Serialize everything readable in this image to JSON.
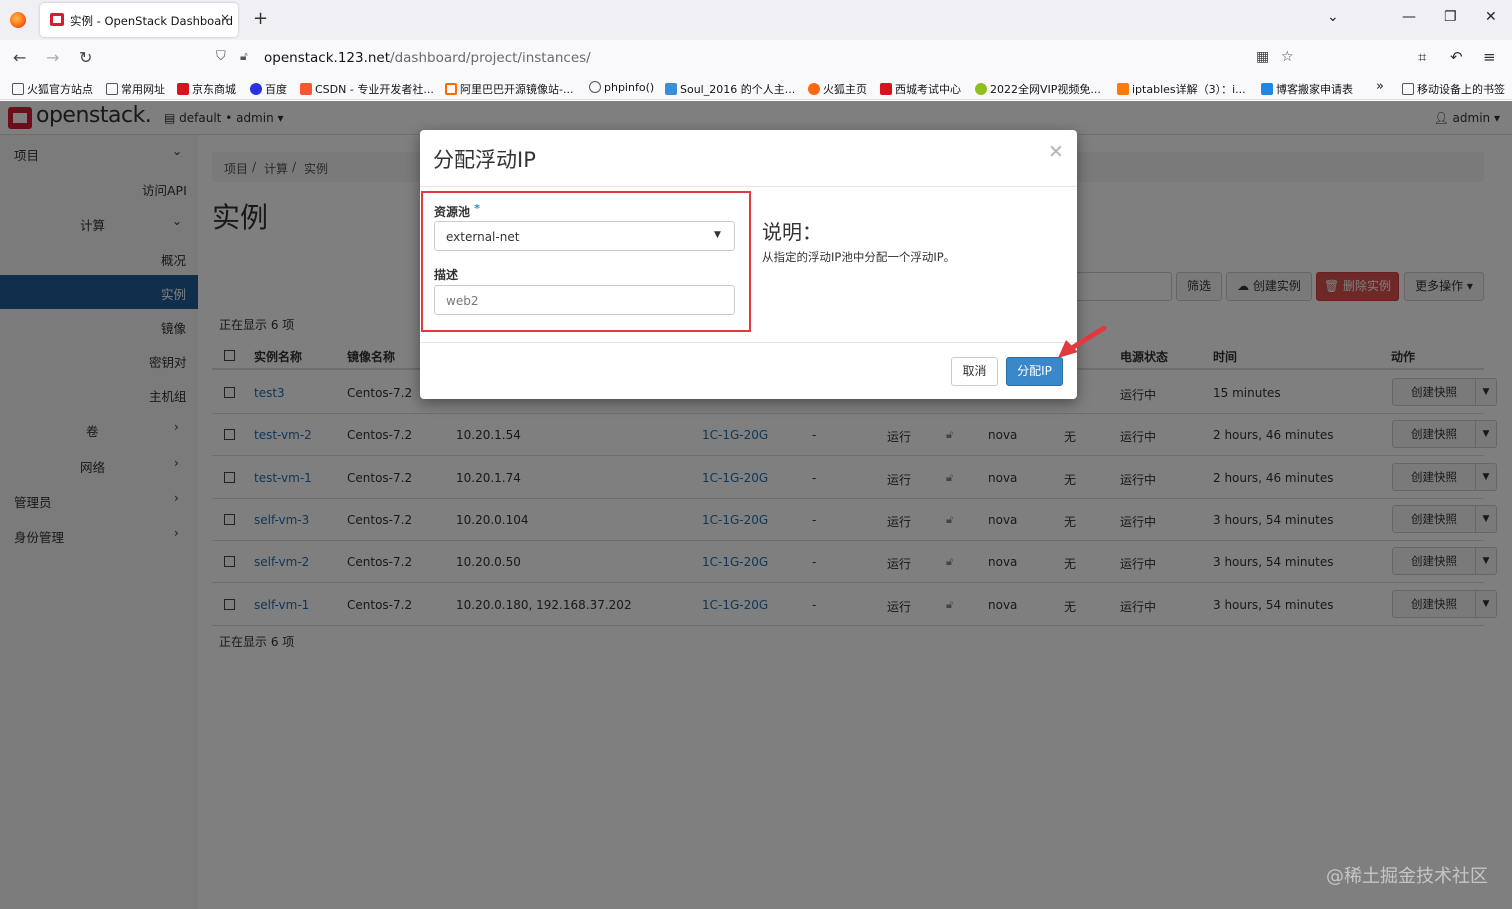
{
  "browser": {
    "tab_title": "实例 - OpenStack Dashboard",
    "tab_close": "×",
    "new_tab": "+",
    "url_host": "openstack.123.net",
    "url_path": "/dashboard/project/instances/",
    "bookmarks": [
      "火狐官方站点",
      "常用网址",
      "京东商城",
      "百度",
      "CSDN - 专业开发者社...",
      "阿里巴巴开源镜像站-...",
      "phpinfo()",
      "Soul_2016 的个人主...",
      "火狐主页",
      "西城考试中心",
      "2022全网VIP视频免...",
      "iptables详解（3）：i...",
      "博客搬家申请表",
      "移动设备上的书签"
    ],
    "colors": {
      "tab_bar": "#f0f0f4",
      "nav_bar": "#f9f9fb"
    }
  },
  "header": {
    "logo_text": "openstack.",
    "project_selector": "default • admin",
    "user_menu": "admin"
  },
  "sidebar": {
    "project": "项目",
    "api_access": "访问API",
    "compute": "计算",
    "overview": "概况",
    "instances": "实例",
    "images": "镜像",
    "key_pairs": "密钥对",
    "server_groups": "主机组",
    "volumes": "卷",
    "network": "网络",
    "admin": "管理员",
    "identity": "身份管理",
    "active_color": "#1e5f99"
  },
  "breadcrumb": [
    "项目",
    "计算",
    "实例"
  ],
  "page_title": "实例",
  "toolbar": {
    "filter": "筛选",
    "create": "创建实例",
    "delete": "删除实例",
    "more": "更多操作"
  },
  "showing_text": "正在显示 6 项",
  "table": {
    "headers": [
      "实例名称",
      "镜像名称",
      "电源状态",
      "时间",
      "动作"
    ],
    "rows": [
      {
        "name": "test3",
        "image": "Centos-7.2",
        "ip": "",
        "flavor": "",
        "keypair": "",
        "status": "",
        "az": "",
        "task": "",
        "power": "运行中",
        "age": "15 minutes",
        "action": "创建快照"
      },
      {
        "name": "test-vm-2",
        "image": "Centos-7.2",
        "ip": "10.20.1.54",
        "flavor": "1C-1G-20G",
        "keypair": "-",
        "status": "运行",
        "az": "nova",
        "task": "无",
        "power": "运行中",
        "age": "2 hours, 46 minutes",
        "action": "创建快照"
      },
      {
        "name": "test-vm-1",
        "image": "Centos-7.2",
        "ip": "10.20.1.74",
        "flavor": "1C-1G-20G",
        "keypair": "-",
        "status": "运行",
        "az": "nova",
        "task": "无",
        "power": "运行中",
        "age": "2 hours, 46 minutes",
        "action": "创建快照"
      },
      {
        "name": "self-vm-3",
        "image": "Centos-7.2",
        "ip": "10.20.0.104",
        "flavor": "1C-1G-20G",
        "keypair": "-",
        "status": "运行",
        "az": "nova",
        "task": "无",
        "power": "运行中",
        "age": "3 hours, 54 minutes",
        "action": "创建快照"
      },
      {
        "name": "self-vm-2",
        "image": "Centos-7.2",
        "ip": "10.20.0.50",
        "flavor": "1C-1G-20G",
        "keypair": "-",
        "status": "运行",
        "az": "nova",
        "task": "无",
        "power": "运行中",
        "age": "3 hours, 54 minutes",
        "action": "创建快照"
      },
      {
        "name": "self-vm-1",
        "image": "Centos-7.2",
        "ip": "10.20.0.180, 192.168.37.202",
        "flavor": "1C-1G-20G",
        "keypair": "-",
        "status": "运行",
        "az": "nova",
        "task": "无",
        "power": "运行中",
        "age": "3 hours, 54 minutes",
        "action": "创建快照"
      }
    ]
  },
  "modal": {
    "title": "分配浮动IP",
    "close": "×",
    "pool_label": "资源池",
    "required_mark": "*",
    "pool_value": "external-net",
    "desc_label": "描述",
    "desc_value": "web2",
    "help_title": "说明：",
    "help_text": "从指定的浮动IP池中分配一个浮动IP。",
    "cancel": "取消",
    "submit": "分配IP",
    "highlight_color": "#e0393e",
    "primary_color": "#3a87c9"
  },
  "watermark": "@稀土掘金技术社区"
}
